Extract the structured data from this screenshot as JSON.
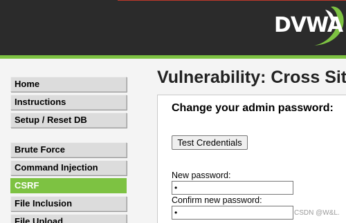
{
  "header": {
    "logo_text": "DVWA"
  },
  "sidebar": {
    "items": [
      {
        "label": "Home"
      },
      {
        "label": "Instructions"
      },
      {
        "label": "Setup / Reset DB"
      },
      {
        "label": "Brute Force"
      },
      {
        "label": "Command Injection"
      },
      {
        "label": "CSRF",
        "selected": true
      },
      {
        "label": "File Inclusion"
      },
      {
        "label": "File Upload"
      }
    ]
  },
  "main": {
    "title": "Vulnerability: Cross Site Request Forgery (CSRF)",
    "form": {
      "heading": "Change your admin password:",
      "test_button_label": "Test Credentials",
      "new_password_label": "New password:",
      "new_password_value": "•",
      "confirm_password_label": "Confirm new password:",
      "confirm_password_value": "•"
    }
  },
  "watermark": "CSDN @W&L.",
  "colors": {
    "header_bg": "#2b2b2b",
    "accent_green": "#7dc242",
    "menu_bg": "#dcdcdc",
    "page_bg": "#f4f4f4"
  }
}
